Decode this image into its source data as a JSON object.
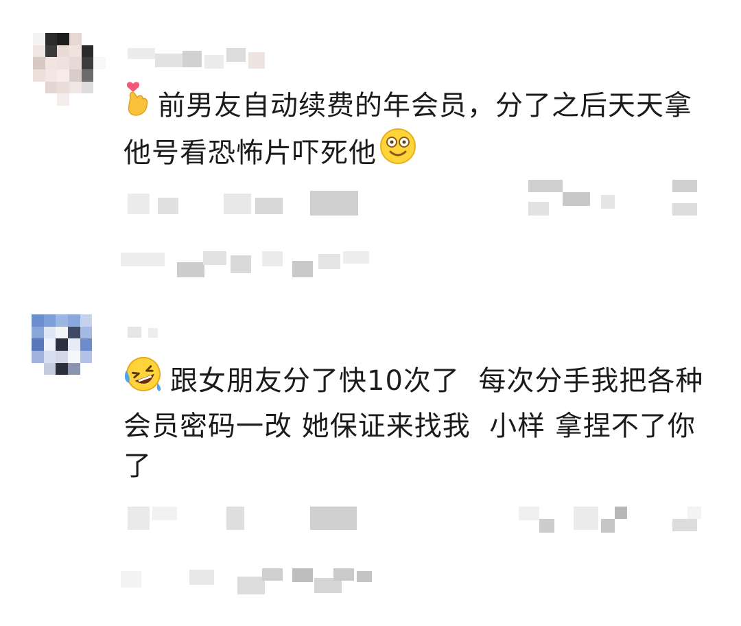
{
  "comments": [
    {
      "leading_emoji": "finger-heart-emoji",
      "text": "前男友自动续费的年会员，分了之后天天拿他号看恐怖片吓死他",
      "trailing_emoji": "dizzy-smile-emoji"
    },
    {
      "leading_emoji": "rofl-emoji",
      "text": "跟女朋友分了快10次了  每次分手我把各种会员密码一改 她保证来找我  小样 拿捏不了你了",
      "trailing_emoji": ""
    }
  ],
  "colors": {
    "background": "#ffffff",
    "text": "#1b1b1b",
    "blur_light": "#ececec",
    "blur_mid": "#d6d6d6",
    "blur_dark": "#a9a9a9"
  }
}
